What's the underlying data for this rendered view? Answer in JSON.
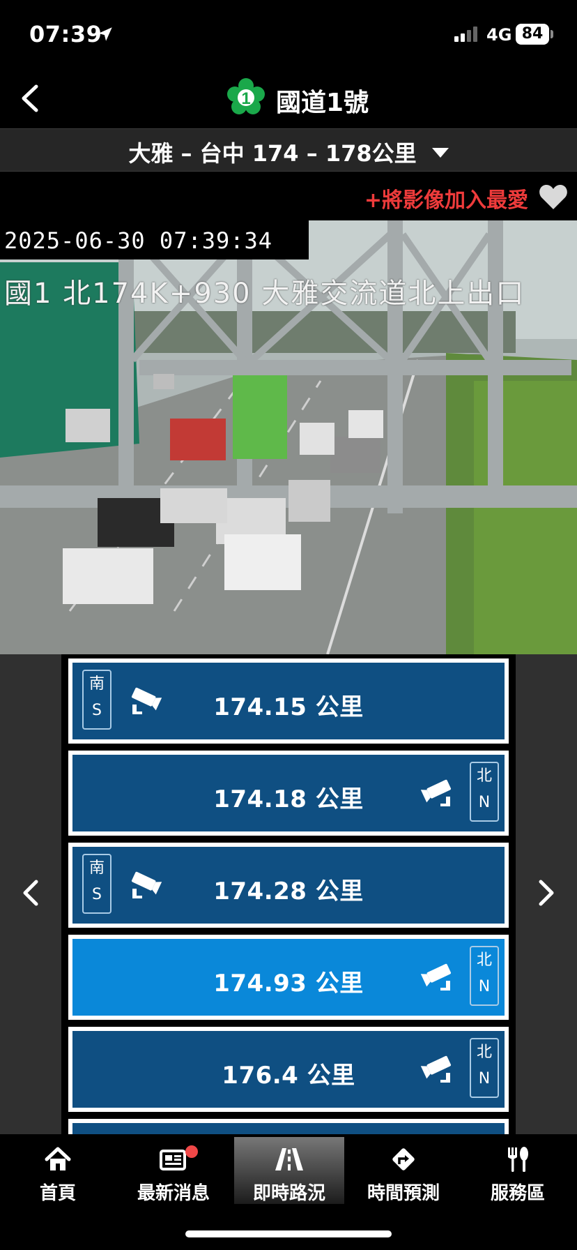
{
  "status_bar": {
    "time": "07:39",
    "network": "4G",
    "battery": "84"
  },
  "header": {
    "route_number": "1",
    "title": "國道1號"
  },
  "section": {
    "label": "大雅 – 台中 174 – 178公里"
  },
  "favorite": {
    "label": "+將影像加入最愛"
  },
  "camera": {
    "timestamp": "2025-06-30 07:39:34",
    "location": "國1 北174K+930 大雅交流道北上出口"
  },
  "camera_list": [
    {
      "km": "174.15 公里",
      "dir_cn": "南",
      "dir_en": "S",
      "side": "left",
      "active": false
    },
    {
      "km": "174.18 公里",
      "dir_cn": "北",
      "dir_en": "N",
      "side": "right",
      "active": false
    },
    {
      "km": "174.28 公里",
      "dir_cn": "南",
      "dir_en": "S",
      "side": "left",
      "active": false
    },
    {
      "km": "174.93 公里",
      "dir_cn": "北",
      "dir_en": "N",
      "side": "right",
      "active": true
    },
    {
      "km": "176.4 公里",
      "dir_cn": "北",
      "dir_en": "N",
      "side": "right",
      "active": false
    }
  ],
  "tabs": [
    {
      "label": "首頁",
      "icon": "home-icon"
    },
    {
      "label": "最新消息",
      "icon": "news-icon"
    },
    {
      "label": "即時路況",
      "icon": "road-icon",
      "active": true
    },
    {
      "label": "時間預測",
      "icon": "route-turn-icon"
    },
    {
      "label": "服務區",
      "icon": "fork-knife-icon"
    }
  ],
  "colors": {
    "item_bg": "#0f4f82",
    "item_active_bg": "#0a88d9",
    "favorite_text": "#ee3b3b",
    "shield_green": "#1aa84a"
  }
}
